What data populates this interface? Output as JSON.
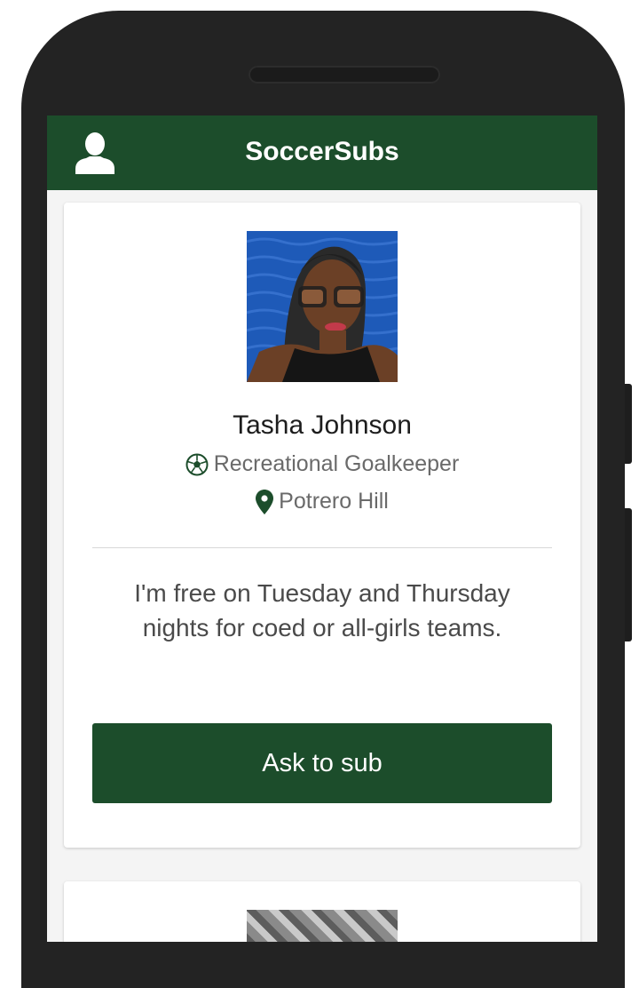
{
  "app": {
    "title": "SoccerSubs",
    "brand_color": "#1c4d2b"
  },
  "header": {
    "profile_icon": "user-icon"
  },
  "profile_card": {
    "name": "Tasha Johnson",
    "level_icon": "soccer-ball-icon",
    "level": "Recreational Goalkeeper",
    "location_icon": "map-pin-icon",
    "location": "Potrero Hill",
    "bio": "I'm free on Tuesday and Thursday nights for coed or all-girls teams.",
    "cta_label": "Ask to sub"
  }
}
